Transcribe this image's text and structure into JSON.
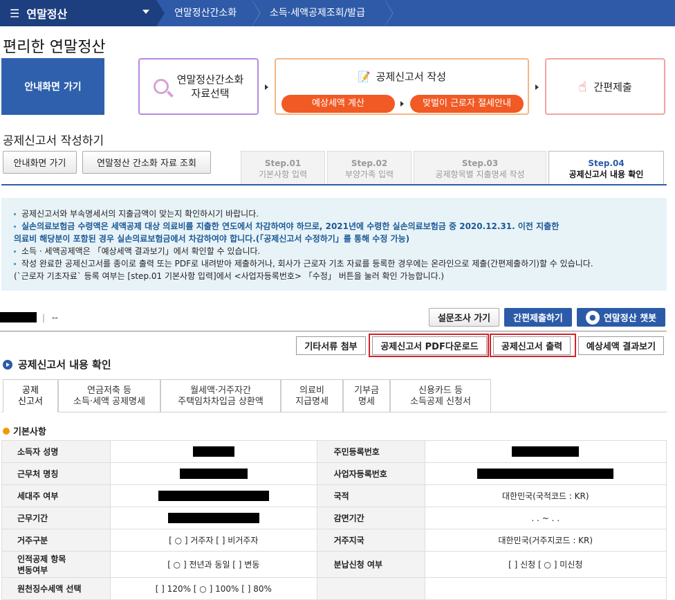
{
  "header": {
    "menu_label": "연말정산",
    "crumb1": "연말정산간소화",
    "crumb2": "소득·세액공제조회/발급"
  },
  "page_title": "편리한 연말정산",
  "flow": {
    "guide": "안내화면 가기",
    "select": "연말정산간소화\n자료선택",
    "write": "공제신고서 작성",
    "calc": "예상세액 계산",
    "couple": "맞벌이 근로자 절세안내",
    "submit": "간편제출"
  },
  "section_title": "공제신고서 작성하기",
  "buttons": {
    "guide": "안내화면 가기",
    "lookup": "연말정산 간소화 자료 조회"
  },
  "steps": [
    {
      "num": "Step.01",
      "label": "기본사항 입력"
    },
    {
      "num": "Step.02",
      "label": "부양가족 입력"
    },
    {
      "num": "Step.03",
      "label": "공제항목별 지출명세 작성"
    },
    {
      "num": "Step.04",
      "label": "공제신고서 내용 확인"
    }
  ],
  "notice": [
    "공제신고서와 부속명세서의 지출금액이 맞는지 확인하시기 바랍니다.",
    "실손의료보험금 수령액은 세액공제 대상 의료비를 지출한 연도에서 차감하여야 하므로, 2021년에 수령한 실손의료보험금 중 2020.12.31. 이전 지출한",
    "의료비 해당분이 포함된 경우 실손의료보험금에서 차감하여야 합니다.(「공제신고서 수정하기」를 통해 수정 가능)",
    "소득 · 세액공제액은 「예상세액 결과보기」에서 확인할 수 있습니다.",
    "작성 완료한 공제신고서를 종이로 출력 또는 PDF로 내려받아 제출하거나, 회사가 근로자 기초 자료를 등록한 경우에는 온라인으로 제출(간편제출하기)할 수 있습니다.",
    "(`근로자 기초자료` 등록 여부는 [step.01 기본사항 입력]에서 <사업자등록번호> 「수정」 버튼을 눌러 확인 가능합니다.)"
  ],
  "user": {
    "sep": "|",
    "dash": "--"
  },
  "actions": {
    "survey": "설문조사 가기",
    "easy_submit": "간편제출하기",
    "chatbot": "연말정산 챗봇"
  },
  "doc_buttons": {
    "etc": "기타서류 첨부",
    "pdf": "공제신고서 PDF다운로드",
    "print": "공제신고서 출력",
    "result": "예상세액 결과보기"
  },
  "confirm_title": "공제신고서 내용 확인",
  "tabs": [
    "공제\n신고서",
    "연금저축 등\n소득·세액 공제명세",
    "월세액·거주자간\n주택임차차입금 상환액",
    "의료비\n지급명세",
    "기부금\n명세",
    "신용카드 등\n소득공제 신청서"
  ],
  "basic_title": "기본사항",
  "table": {
    "name": "소득자 성명",
    "rrn": "주민등록번호",
    "work": "근무처 명칭",
    "bizno": "사업자등록번호",
    "head": "세대주 여부",
    "nation": "국적",
    "nation_val": "대한민국(국적코드 : KR)",
    "period": "근무기간",
    "reduce": "감면기간",
    "reduce_val": ". . ~ . .",
    "resident": "거주구분",
    "resident_val": "[ ○ ] 거주자  [    ] 비거주자",
    "region": "거주지국",
    "region_val": "대한민국(거주지코드 : KR)",
    "change": "인적공제 항목\n변동여부",
    "change_val": "[ ○ ] 전년과 동일  [    ] 변동",
    "install": "분납신청 여부",
    "install_val": "[    ] 신청 [ ○ ] 미신청",
    "last": "원천징수세액 선택",
    "last_val": "[    ] 120%  [ ○ ] 100%  [    ] 80%"
  }
}
